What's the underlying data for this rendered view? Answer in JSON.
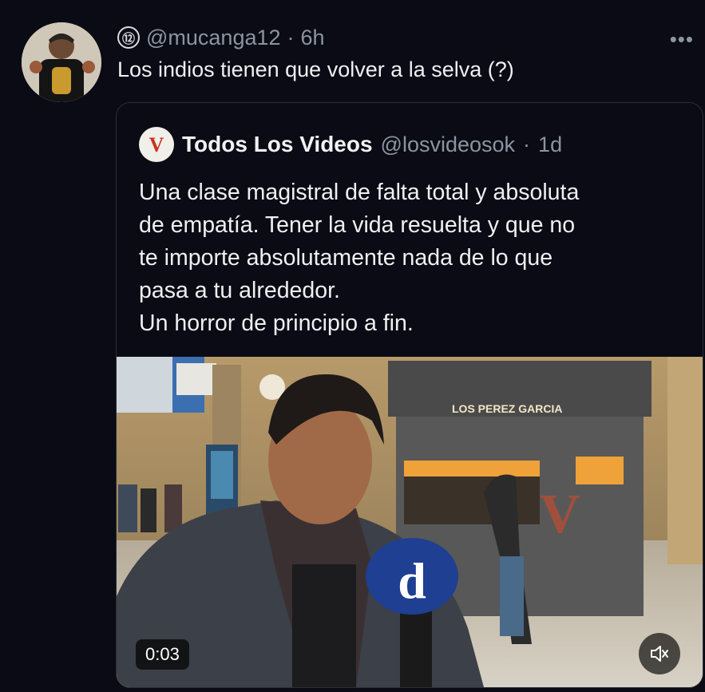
{
  "tweet": {
    "verified_number": "⑫",
    "handle": "@mucanga12",
    "separator": "·",
    "time": "6h",
    "text": "Los indios tienen que volver a la selva (?)",
    "more_icon": "more-icon"
  },
  "quoted": {
    "logo_letter": "V",
    "name": "Todos Los Videos",
    "handle": "@losvideosok",
    "separator": "·",
    "time": "1d",
    "lines": [
      "Una clase magistral de falta total y absoluta",
      "de empatía. Tener la vida resuelta y que no",
      "te importe absolutamente nada de lo que",
      "pasa a tu alrededor.",
      "Un horror de principio a fin."
    ],
    "video": {
      "duration": "0:03",
      "kiosk_sign": "LOS PEREZ GARCIA",
      "mic_logo": "d",
      "watermark": "V"
    }
  },
  "colors": {
    "bg": "#0a0b14",
    "muted": "#8b95a1",
    "border": "#2a2f38"
  }
}
